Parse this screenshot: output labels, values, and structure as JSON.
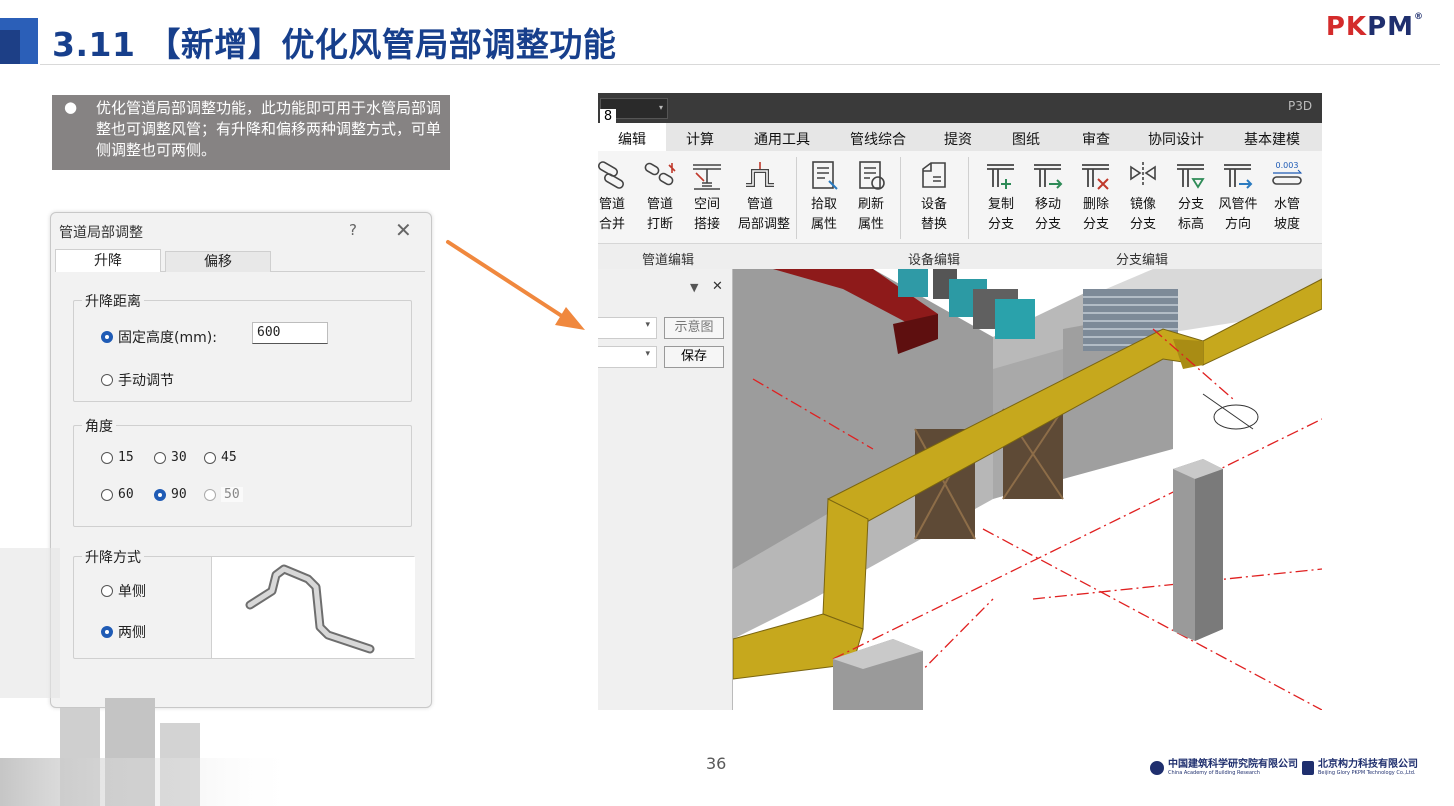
{
  "slide": {
    "title": "3.11 【新增】优化风管局部调整功能",
    "logo": {
      "part1": "P",
      "part2": "K",
      "part3": "P",
      "part4": "M",
      "reg": "®"
    },
    "page_number": "36",
    "note_bullet": "●",
    "note_text": "优化管道局部调整功能，此功能即可用于水管局部调整也可调整风管；有升降和偏移两种调整方式，可单侧调整也可两侧。",
    "footer": {
      "org1_cn": "中国建筑科学研究院有限公司",
      "org1_en": "China Academy of Building Research",
      "org2_cn": "北京构力科技有限公司",
      "org2_en": "Beijing Glory PKPM Technology Co.,Ltd."
    },
    "colors": {
      "title": "#173f8c",
      "accent": "#2b5fb8",
      "arrow": "#f0883e",
      "note_bg": "#868383"
    }
  },
  "dialog": {
    "title": "管道局部调整",
    "help": "?",
    "close": "✕",
    "tabs": [
      "升降",
      "偏移"
    ],
    "active_tab": "升降",
    "lift_distance": {
      "label": "升降距离",
      "fixed_label": "固定高度(mm):",
      "fixed_value": "600",
      "fixed_selected": true,
      "manual_label": "手动调节"
    },
    "angle": {
      "label": "角度",
      "options": [
        "15",
        "30",
        "45",
        "60",
        "90",
        "50"
      ],
      "selected": "90"
    },
    "mode": {
      "label": "升降方式",
      "single": "单侧",
      "both": "两侧",
      "selected": "两侧"
    }
  },
  "cad": {
    "tab_number": "8",
    "app_label": "P3D",
    "menu": [
      "编辑",
      "计算",
      "通用工具",
      "管线综合",
      "提资",
      "图纸",
      "审查",
      "协同设计",
      "基本建模"
    ],
    "active_menu": "编辑",
    "tools": [
      {
        "l1": "管道",
        "l2": "合并",
        "icon": "pipe-merge-icon"
      },
      {
        "l1": "管道",
        "l2": "打断",
        "icon": "pipe-break-icon"
      },
      {
        "l1": "空间",
        "l2": "搭接",
        "icon": "space-lap-icon"
      },
      {
        "l1": "管道",
        "l2": "局部调整",
        "icon": "pipe-local-adjust-icon"
      },
      {
        "l1": "拾取",
        "l2": "属性",
        "icon": "pick-attr-icon"
      },
      {
        "l1": "刷新",
        "l2": "属性",
        "icon": "refresh-attr-icon"
      },
      {
        "l1": "设备",
        "l2": "替换",
        "icon": "equip-replace-icon"
      },
      {
        "l1": "复制",
        "l2": "分支",
        "icon": "copy-branch-icon"
      },
      {
        "l1": "移动",
        "l2": "分支",
        "icon": "move-branch-icon"
      },
      {
        "l1": "删除",
        "l2": "分支",
        "icon": "delete-branch-icon"
      },
      {
        "l1": "镜像",
        "l2": "分支",
        "icon": "mirror-branch-icon"
      },
      {
        "l1": "分支",
        "l2": "标高",
        "icon": "branch-elev-icon"
      },
      {
        "l1": "风管件",
        "l2": "方向",
        "icon": "duct-fitting-dir-icon"
      },
      {
        "l1": "水管",
        "l2": "坡度",
        "icon": "pipe-slope-icon"
      }
    ],
    "slope_icon_text": "0.003",
    "groups": [
      "管道编辑",
      "设备编辑",
      "分支编辑"
    ],
    "panel": {
      "pin": "▼",
      "close": "✕",
      "btn1": "示意图",
      "btn2": "保存"
    }
  }
}
